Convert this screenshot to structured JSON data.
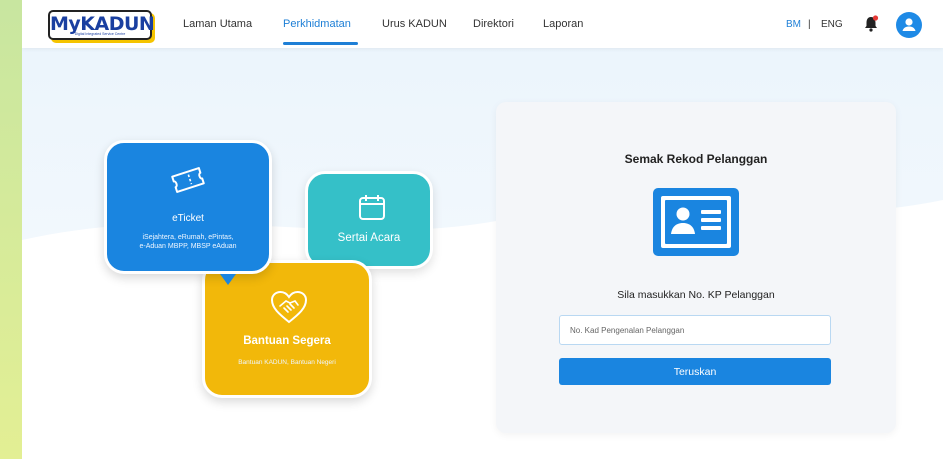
{
  "header": {
    "logo_text": "MyKADUN",
    "logo_subtitle": "Digital Integrated Service Centre",
    "nav": [
      {
        "label": "Laman Utama"
      },
      {
        "label": "Perkhidmatan"
      },
      {
        "label": "Urus KADUN"
      },
      {
        "label": "Direktori"
      },
      {
        "label": "Laporan"
      }
    ],
    "active_nav": "Perkhidmatan",
    "lang_bm": "BM",
    "lang_separator": "|",
    "lang_eng": "ENG",
    "active_lang": "BM",
    "icons": [
      "bell-icon",
      "user-icon"
    ]
  },
  "services": {
    "eticket": {
      "title": "eTicket",
      "desc_line1": "iSejahtera, eRumah, ePintas,",
      "desc_line2": "e-Aduan MBPP, MBSP eAduan",
      "icon": "ticket-icon"
    },
    "sertai": {
      "title": "Sertai Acara",
      "icon": "calendar-icon"
    },
    "bantuan": {
      "title": "Bantuan Segera",
      "desc": "Bantuan KADUN, Bantuan Negeri",
      "icon": "handshake-heart-icon"
    }
  },
  "card": {
    "title": "Semak Rekod Pelanggan",
    "icon": "id-card-icon",
    "prompt": "Sila masukkan No. KP Pelanggan",
    "input_placeholder": "No. Kad Pengenalan Pelanggan",
    "input_value": "",
    "button_label": "Teruskan"
  },
  "colors": {
    "primary": "#1a85e0",
    "teal": "#35c0c8",
    "yellow": "#f2b80a",
    "logo_accent": "#f5c400"
  }
}
